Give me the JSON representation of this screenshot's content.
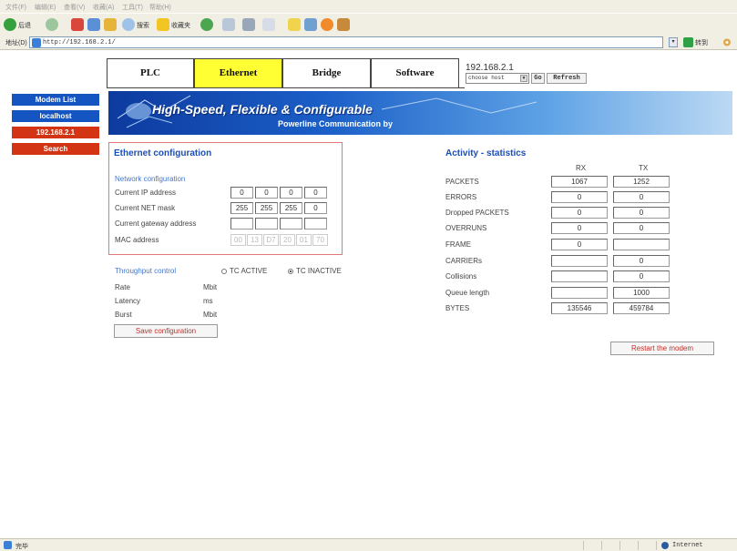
{
  "browser": {
    "menu": [
      "文件(F)",
      "编辑(E)",
      "查看(V)",
      "收藏(A)",
      "工具(T)",
      "帮助(H)"
    ],
    "toolbar": {
      "back_label": "后退",
      "search_label": "搜索",
      "favorites_label": "收藏夹"
    },
    "address_label": "地址(D)",
    "address_value": "http://192.168.2.1/",
    "go_label": "转到",
    "status_text": "完毕",
    "status_zone": "Internet"
  },
  "tabs": [
    {
      "label": "PLC",
      "active": false
    },
    {
      "label": "Ethernet",
      "active": true
    },
    {
      "label": "Bridge",
      "active": false
    },
    {
      "label": "Software",
      "active": false
    }
  ],
  "host": {
    "ip": "192.168.2.1",
    "select_value": "choose host",
    "go_label": "Go",
    "refresh_label": "Refresh"
  },
  "sidebar": [
    {
      "label": "Modem List",
      "color": "#1455c2"
    },
    {
      "label": "localhost",
      "color": "#1455c2"
    },
    {
      "label": "192.168.2.1",
      "color": "#d23414"
    },
    {
      "label": "Search",
      "color": "#d23414"
    }
  ],
  "banner": {
    "title": "High-Speed, Flexible & Configurable",
    "subtitle": "Powerline Communication by"
  },
  "ethernet": {
    "title": "Ethernet configuration",
    "network_title": "Network configuration",
    "rows": [
      {
        "label": "Current IP address",
        "values": [
          "0",
          "0",
          "0",
          "0"
        ]
      },
      {
        "label": "Current NET mask",
        "values": [
          "255",
          "255",
          "255",
          "0"
        ]
      },
      {
        "label": "Current gateway address",
        "values": [
          "",
          "",
          "",
          ""
        ]
      }
    ],
    "mac_label": "MAC address",
    "mac_values": [
      "00",
      "13",
      "D7",
      "20",
      "01",
      "70"
    ],
    "throughput_title": "Throughput control",
    "tc_active_label": "TC ACTIVE",
    "tc_inactive_label": "TC INACTIVE",
    "tc_selected": "inactive",
    "rate_label": "Rate",
    "rate_unit": "Mbit",
    "latency_label": "Latency",
    "latency_unit": "ms",
    "burst_label": "Burst",
    "burst_unit": "Mbit",
    "save_label": "Save configuration"
  },
  "stats": {
    "title": "Activity - statistics",
    "rx_header": "RX",
    "tx_header": "TX",
    "rows": [
      {
        "label": "PACKETS",
        "rx": "1067",
        "tx": "1252"
      },
      {
        "label": "ERRORS",
        "rx": "0",
        "tx": "0"
      },
      {
        "label": "Dropped PACKETS",
        "rx": "0",
        "tx": "0"
      },
      {
        "label": "OVERRUNS",
        "rx": "0",
        "tx": "0"
      },
      {
        "label": "FRAME",
        "rx": "0",
        "tx": ""
      },
      {
        "label": "CARRIERs",
        "rx": "",
        "tx": "0"
      },
      {
        "label": "Collisions",
        "rx": "",
        "tx": "0"
      },
      {
        "label": "Queue length",
        "rx": "",
        "tx": "1000"
      },
      {
        "label": "BYTES",
        "rx": "135546",
        "tx": "459784"
      }
    ],
    "restart_label": "Restart the modem"
  }
}
